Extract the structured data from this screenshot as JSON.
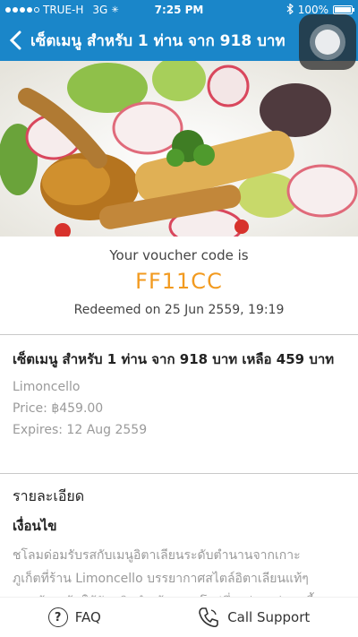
{
  "status_bar": {
    "carrier": "TRUE-H",
    "network": "3G",
    "time": "7:25 PM",
    "battery": "100%",
    "battery_level": 1.0
  },
  "nav": {
    "title": "เซ็ตเมนู สำหรับ 1 ท่าน จาก 918 บาท"
  },
  "voucher": {
    "label": "Your voucher code is",
    "code": "FF11CC",
    "redeemed": "Redeemed on 25 Jun 2559, 19:19"
  },
  "deal": {
    "title": "เซ็ตเมนู สำหรับ 1 ท่าน จาก 918 บาท เหลือ 459 บาท",
    "merchant": "Limoncello",
    "price": "Price: ฿459.00",
    "expires": "Expires: 12 Aug 2559"
  },
  "description": {
    "heading": "รายละเอียด",
    "subheading": "เงื่อนไข",
    "lines": [
      "ชโลมด่อมรับรสกับเมนูอิตาเลียนระดับตำนานจากเกาะ",
      "ภูเก็ตที่ร้าน Limoncello บรรยากาศสไตล์อิตาเลียนแท้ๆ",
      "เทางร้านเน้นใช้วัตถดิบนำเข้าจากยโรปซึ่งแต่ละอย่างๆ นี้"
    ]
  },
  "bottom_bar": {
    "faq": "FAQ",
    "support": "Call Support"
  },
  "colors": {
    "brand": "#1a86c9",
    "code": "#f29a1f"
  }
}
